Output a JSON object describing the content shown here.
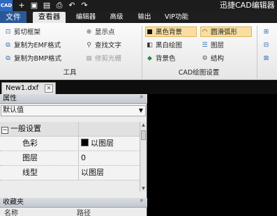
{
  "titlebar": {
    "logo_text": "CAD",
    "app_title": "迅捷CAD编辑器",
    "quick_access": [
      {
        "icon": "plus-icon",
        "glyph": "+"
      },
      {
        "icon": "save-icon",
        "glyph": "▣"
      },
      {
        "icon": "save-all-icon",
        "glyph": "▤"
      },
      {
        "icon": "print-icon",
        "glyph": "⎙"
      },
      {
        "icon": "undo-icon",
        "glyph": "↶"
      },
      {
        "icon": "redo-icon",
        "glyph": "↷"
      }
    ]
  },
  "menu": {
    "file": "文件",
    "tabs": [
      "查看器",
      "编辑器",
      "高级",
      "输出",
      "VIP功能"
    ],
    "active": "查看器"
  },
  "ribbon": {
    "tools_group": {
      "label": "工具",
      "buttons": [
        {
          "label": "剪切框架",
          "icon": "crop-frame-icon",
          "glyph": "⊡"
        },
        {
          "label": "复制为EMF格式",
          "icon": "copy-emf-icon",
          "glyph": "⧉"
        },
        {
          "label": "复制为BMP格式",
          "icon": "copy-bmp-icon",
          "glyph": "⧉"
        },
        {
          "label": "显示点",
          "icon": "show-points-icon",
          "glyph": "⊕"
        },
        {
          "label": "查找文字",
          "icon": "find-text-icon",
          "glyph": "⚲"
        },
        {
          "label": "修剪光栅",
          "icon": "trim-raster-icon",
          "glyph": "▦",
          "disabled": true
        }
      ]
    },
    "cad_group": {
      "label": "CAD绘图设置",
      "buttons": [
        {
          "label": "黑色背景",
          "icon": "black-background-icon",
          "glyph": "■",
          "selected": true
        },
        {
          "label": "黑白绘图",
          "icon": "monochrome-icon",
          "glyph": "◧"
        },
        {
          "label": "背景色",
          "icon": "background-color-icon",
          "glyph": "◆"
        },
        {
          "label": "圆滑弧形",
          "icon": "smooth-arc-icon",
          "glyph": "◠",
          "selected": true
        },
        {
          "label": "图层",
          "icon": "layers-icon",
          "glyph": "☰"
        },
        {
          "label": "结构",
          "icon": "structure-icon",
          "glyph": "⚙"
        }
      ]
    },
    "right_group_icons": [
      {
        "icon": "view-icon-1",
        "glyph": "⊞"
      },
      {
        "icon": "view-icon-2",
        "glyph": "⊟"
      },
      {
        "icon": "view-icon-3",
        "glyph": "⊠"
      }
    ]
  },
  "document": {
    "tab_label": "New1.dxf",
    "close_glyph": "✕"
  },
  "properties": {
    "title": "属性",
    "pin_glyph": "ᵖ",
    "selector_value": "默认值",
    "category": "一般设置",
    "rows": [
      {
        "name": "色彩",
        "value": "以图层",
        "swatch": "#000000"
      },
      {
        "name": "图层",
        "value": "0"
      },
      {
        "name": "线型",
        "value": "以图层"
      }
    ]
  },
  "favorites": {
    "title": "收藏夹",
    "pin_glyph": "ᵖ",
    "col_name": "名称",
    "col_path": "路径"
  }
}
